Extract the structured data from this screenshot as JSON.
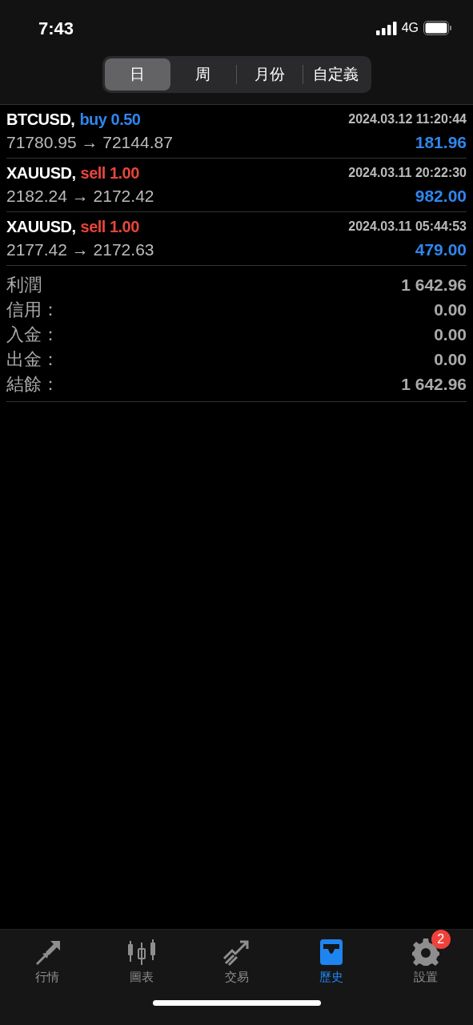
{
  "status_bar": {
    "time": "7:43",
    "network": "4G"
  },
  "segments": [
    {
      "label": "日",
      "selected": true
    },
    {
      "label": "周",
      "selected": false
    },
    {
      "label": "月份",
      "selected": false
    },
    {
      "label": "自定義",
      "selected": false
    }
  ],
  "deals": [
    {
      "symbol": "BTCUSD,",
      "side": "buy",
      "lots": "0.50",
      "time": "2024.03.12 11:20:44",
      "prices": "71780.95 → 72144.87",
      "profit": "181.96"
    },
    {
      "symbol": "XAUUSD,",
      "side": "sell",
      "lots": "1.00",
      "time": "2024.03.11 20:22:30",
      "prices": "2182.24 → 2172.42",
      "profit": "982.00"
    },
    {
      "symbol": "XAUUSD,",
      "side": "sell",
      "lots": "1.00",
      "time": "2024.03.11 05:44:53",
      "prices": "2177.42 → 2172.63",
      "profit": "479.00"
    }
  ],
  "summary": [
    {
      "label": "利潤",
      "value": "1 642.96"
    },
    {
      "label": "信用：",
      "value": "0.00"
    },
    {
      "label": "入金：",
      "value": "0.00"
    },
    {
      "label": "出金：",
      "value": "0.00"
    },
    {
      "label": "結餘：",
      "value": "1 642.96"
    }
  ],
  "tab_bar": [
    {
      "kind": "quotes",
      "label": "行情",
      "selected": false
    },
    {
      "kind": "chart",
      "label": "圖表",
      "selected": false
    },
    {
      "kind": "trade",
      "label": "交易",
      "selected": false
    },
    {
      "kind": "history",
      "label": "歷史",
      "selected": true
    },
    {
      "kind": "settings",
      "label": "設置",
      "selected": false,
      "badge": "2"
    }
  ]
}
